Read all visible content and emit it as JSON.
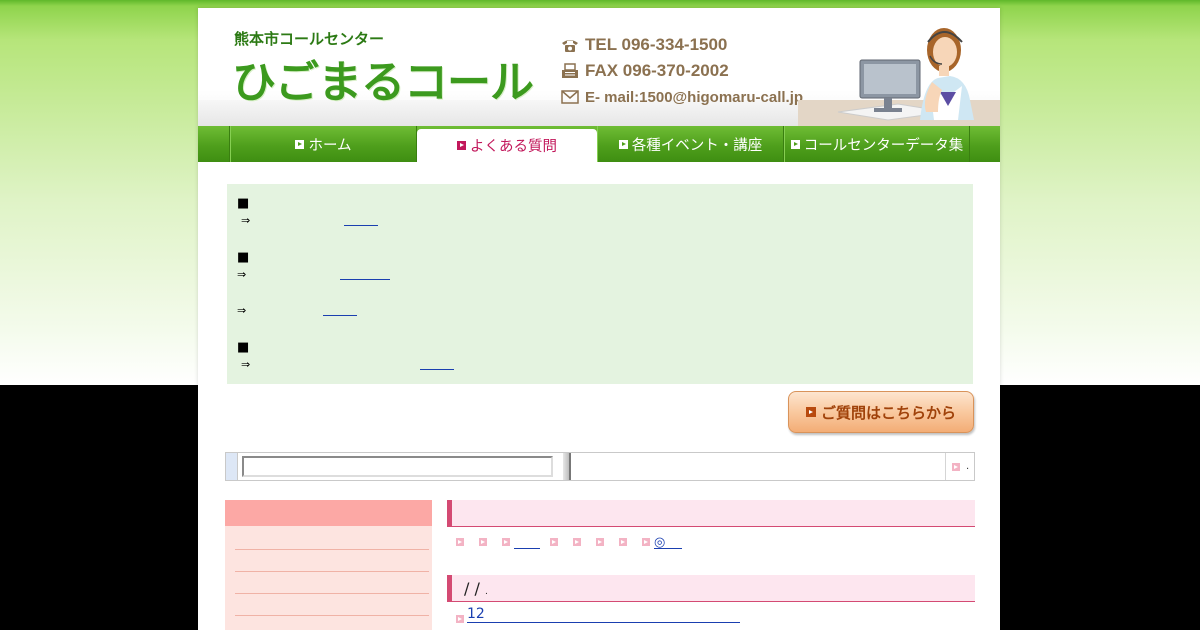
{
  "header": {
    "sub_logo": "熊本市コールセンター",
    "main_logo": "ひごまるコール",
    "tel": "TEL 096-334-1500",
    "fax": "FAX 096-370-2002",
    "email": "E- mail:1500@higomaru-call.jp"
  },
  "icons": {
    "phone": "phone-icon",
    "fax": "fax-icon",
    "mail": "mail-icon",
    "nav_arrow": "arrow-right-icon"
  },
  "colors": {
    "brand_green": "#4f9f1c",
    "active_tab_text": "#c2185b",
    "faq_bg": "#e4f3e0",
    "accent_pink": "#d44a73",
    "button_orange": "#f9c99f",
    "link_blue": "#1a3fb0"
  },
  "nav": {
    "items": [
      {
        "label": "ホーム"
      },
      {
        "label": "よくある質問"
      },
      {
        "label": "各種イベント・講座"
      },
      {
        "label": "コールセンターデータ集"
      }
    ]
  },
  "faq": {
    "square": "■",
    "arrow": "⇒"
  },
  "ask_button": "ご質問はこちらから",
  "search": {
    "value": "",
    "trailing": "."
  },
  "content": {
    "section2_title": "/ /",
    "section2_suffix": ".",
    "crumb_mark": "◎",
    "item_number": "12"
  }
}
